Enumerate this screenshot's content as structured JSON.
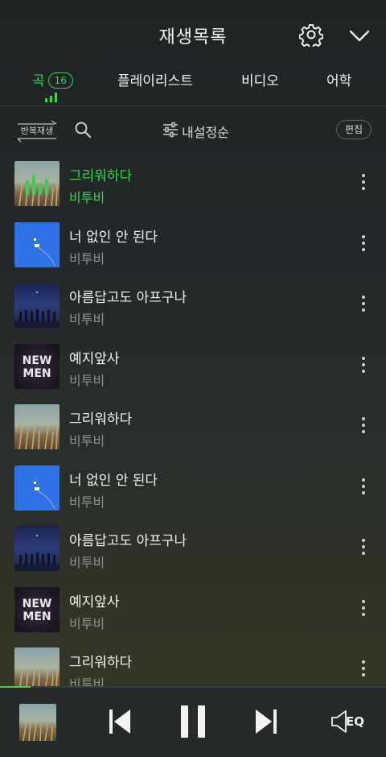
{
  "header": {
    "title": "재생목록"
  },
  "tabs": [
    {
      "label": "곡",
      "count": "16",
      "active": true
    },
    {
      "label": "플레이리스트"
    },
    {
      "label": "비디오"
    },
    {
      "label": "어학"
    }
  ],
  "toolbar": {
    "repeat_label": "반복재생",
    "sort_label": "내설정순",
    "edit_label": "편집"
  },
  "songs": [
    {
      "title": "그리워하다",
      "artist": "비투비",
      "art": "field",
      "current": true
    },
    {
      "title": "너 없인 안 된다",
      "artist": "비투비",
      "art": "blue"
    },
    {
      "title": "아름답고도 아프구나",
      "artist": "비투비",
      "art": "night"
    },
    {
      "title": "예지앞사",
      "artist": "비투비",
      "art": "newmen"
    },
    {
      "title": "그리워하다",
      "artist": "비투비",
      "art": "field"
    },
    {
      "title": "너 없인 안 된다",
      "artist": "비투비",
      "art": "blue"
    },
    {
      "title": "아름답고도 아프구나",
      "artist": "비투비",
      "art": "night"
    },
    {
      "title": "예지앞사",
      "artist": "비투비",
      "art": "newmen"
    },
    {
      "title": "그리워하다",
      "artist": "비투비",
      "art": "field"
    }
  ],
  "art_text": {
    "newmen_line1": "NEW",
    "newmen_line2": "MEN"
  },
  "player": {
    "eq_label": "EQ",
    "progress": 0.08
  },
  "colors": {
    "accent": "#3fcf50",
    "background": "#23292a",
    "muted": "#8c9090"
  }
}
